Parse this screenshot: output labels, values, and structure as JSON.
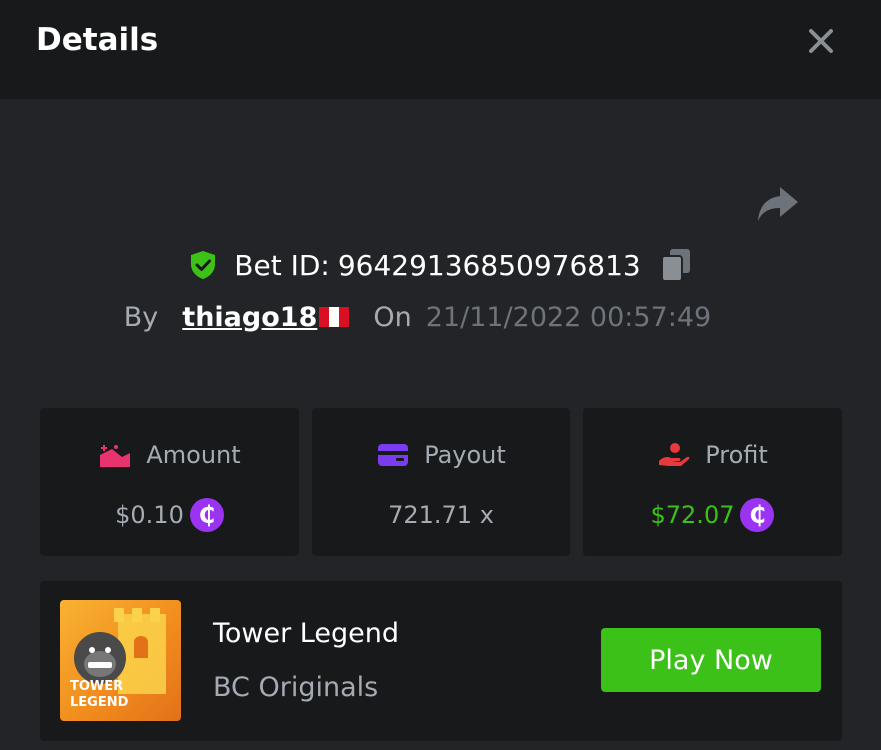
{
  "header": {
    "title": "Details"
  },
  "bet": {
    "id_label": "Bet ID:",
    "id": "96429136850976813",
    "by_label": "By",
    "user": "thiago18",
    "on_label": "On",
    "date": "21/11/2022 00:57:49"
  },
  "stats": {
    "amount": {
      "label": "Amount",
      "value": "$0.10",
      "coin": "₵"
    },
    "payout": {
      "label": "Payout",
      "value": "721.71 x"
    },
    "profit": {
      "label": "Profit",
      "value": "$72.07",
      "coin": "₵"
    }
  },
  "game": {
    "title": "Tower Legend",
    "provider": "BC Originals",
    "thumb_text_1": "TOWER",
    "thumb_text_2": "LEGEND",
    "play_label": "Play Now"
  },
  "icons": {
    "close": "close-icon",
    "share": "share-icon",
    "verified": "shield-check-icon",
    "copy": "copy-icon",
    "amount": "amount-icon",
    "payout": "wallet-icon",
    "profit": "profit-icon",
    "coin": "coin-icon",
    "flag": "peru-flag-icon"
  },
  "colors": {
    "accent_green": "#3bc117",
    "coin_purple": "#9b34f2",
    "amount_pink": "#e8336f",
    "payout_purple": "#7b3cf0",
    "profit_red": "#e83a3a",
    "shield_green": "#3bc117"
  }
}
